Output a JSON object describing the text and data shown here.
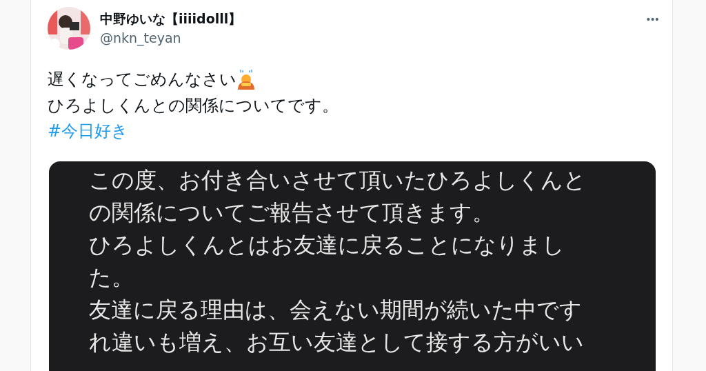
{
  "author": {
    "name": "中野ゆいな【iiiidolll】",
    "handle": "@nkn_teyan"
  },
  "menu": {
    "label": "•••"
  },
  "text_lines": [
    {
      "text": "遅くなってごめんなさい",
      "bowing_emoji": true
    },
    {
      "text": "ひろよしくんとの関係についてです。"
    }
  ],
  "hashtag": "#今日好き",
  "image": {
    "lines": [
      "この度、お付き合いさせて頂いたひろよしくんと",
      "の関係についてご報告させて頂きます。",
      "ひろよしくんとはお友達に戻ることになりまし",
      "た。",
      "友達に戻る理由は、会えない期間が続いた中です",
      "れ違いも増え、お互い友達として接する方がいい"
    ]
  }
}
